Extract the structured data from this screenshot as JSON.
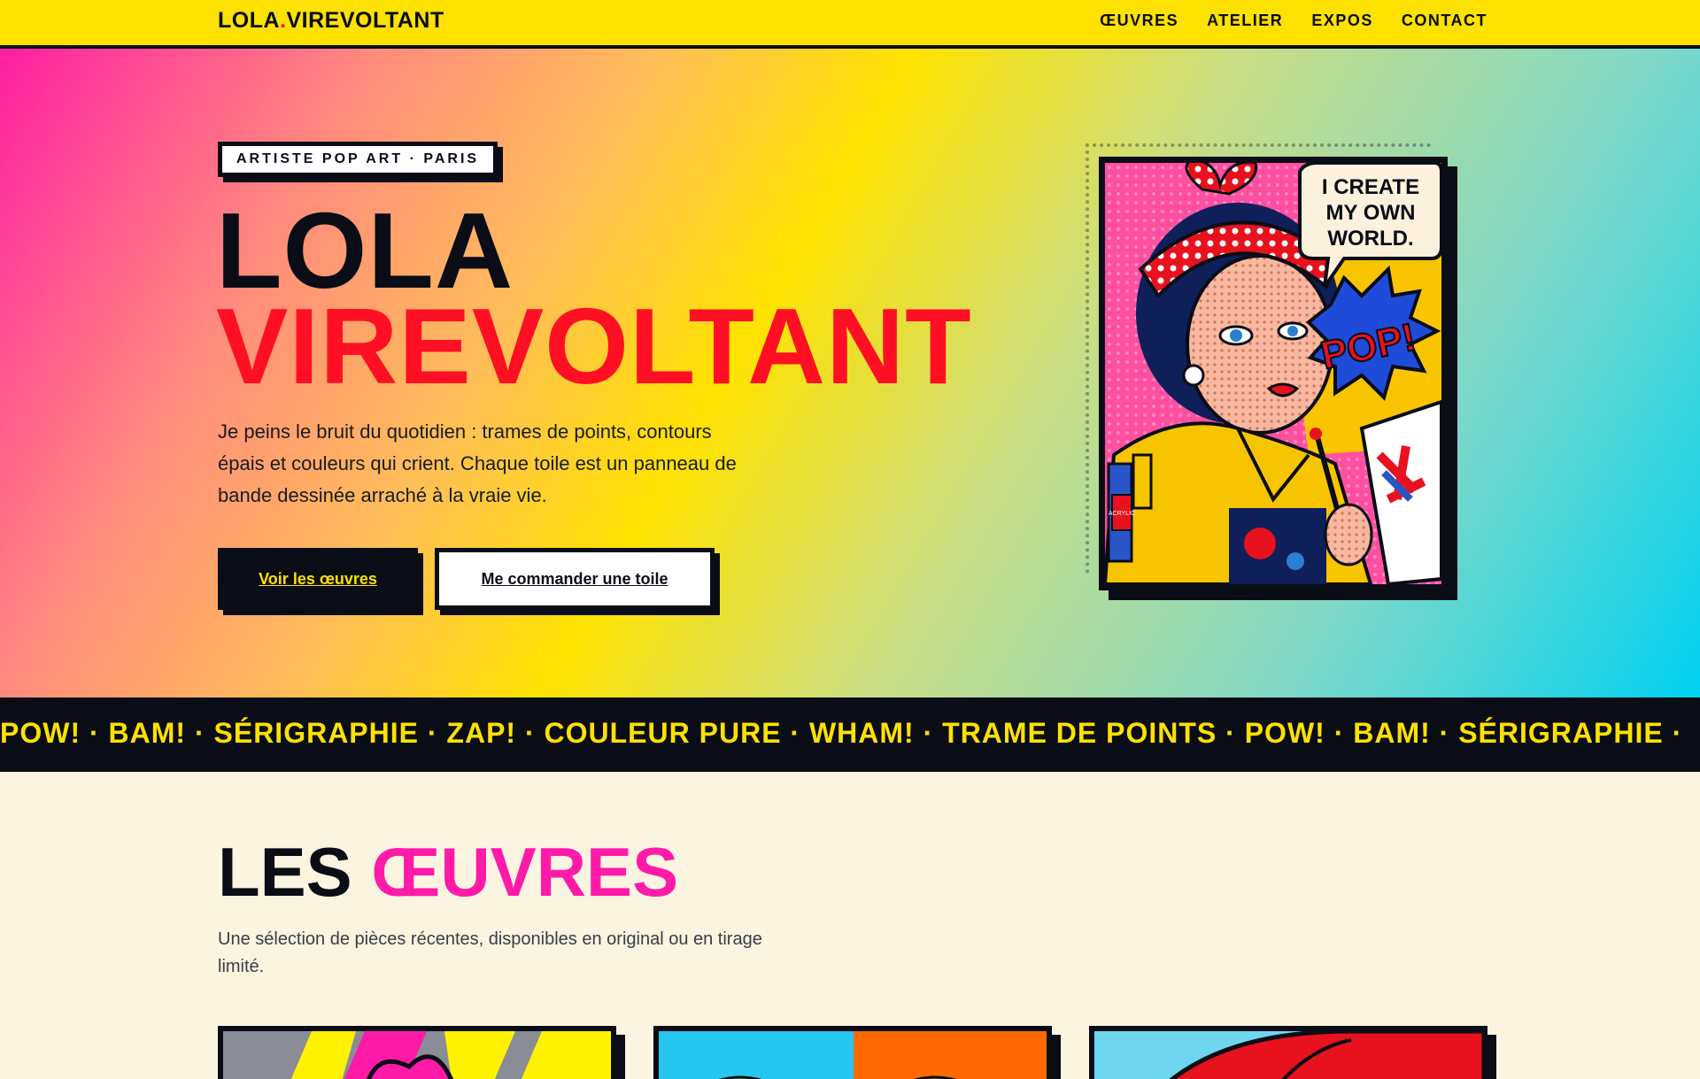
{
  "header": {
    "logo_part1": "LOLA",
    "logo_dot": ".",
    "logo_part2": "VIREVOLTANT",
    "nav": [
      "ŒUVRES",
      "ATELIER",
      "EXPOS",
      "CONTACT"
    ]
  },
  "hero": {
    "tag": "ARTISTE POP ART · PARIS",
    "title_line1": "LOLA",
    "title_line2": "VIREVOLTANT",
    "lede": "Je peins le bruit du quotidien : trames de points, contours épais et couleurs qui crient. Chaque toile est un panneau de bande dessinée arraché à la vraie vie.",
    "primary_button": "Voir les œuvres",
    "secondary_button": "Me commander une toile",
    "artwork": {
      "speech_bubble": [
        "I CREATE",
        "MY OWN",
        "WORLD."
      ],
      "burst": "POP!",
      "jar_label": "ACRYLIC"
    }
  },
  "ticker": {
    "text": "POW! · BAM! · SÉRIGRAPHIE · ZAP! · COULEUR PURE · WHAM! · TRAME DE POINTS · POW! · BAM! · SÉRIGRAPHIE ·"
  },
  "works": {
    "title": "LES",
    "title_accent": "ŒUVRES",
    "subtitle": "Une sélection de pièces récentes, disponibles en original ou en tirage limité."
  },
  "colors": {
    "yellow": "#fde100",
    "ink": "#0a0d16",
    "red": "#ff0f24",
    "magenta": "#ff1aa8",
    "cream": "#faf4e0"
  }
}
